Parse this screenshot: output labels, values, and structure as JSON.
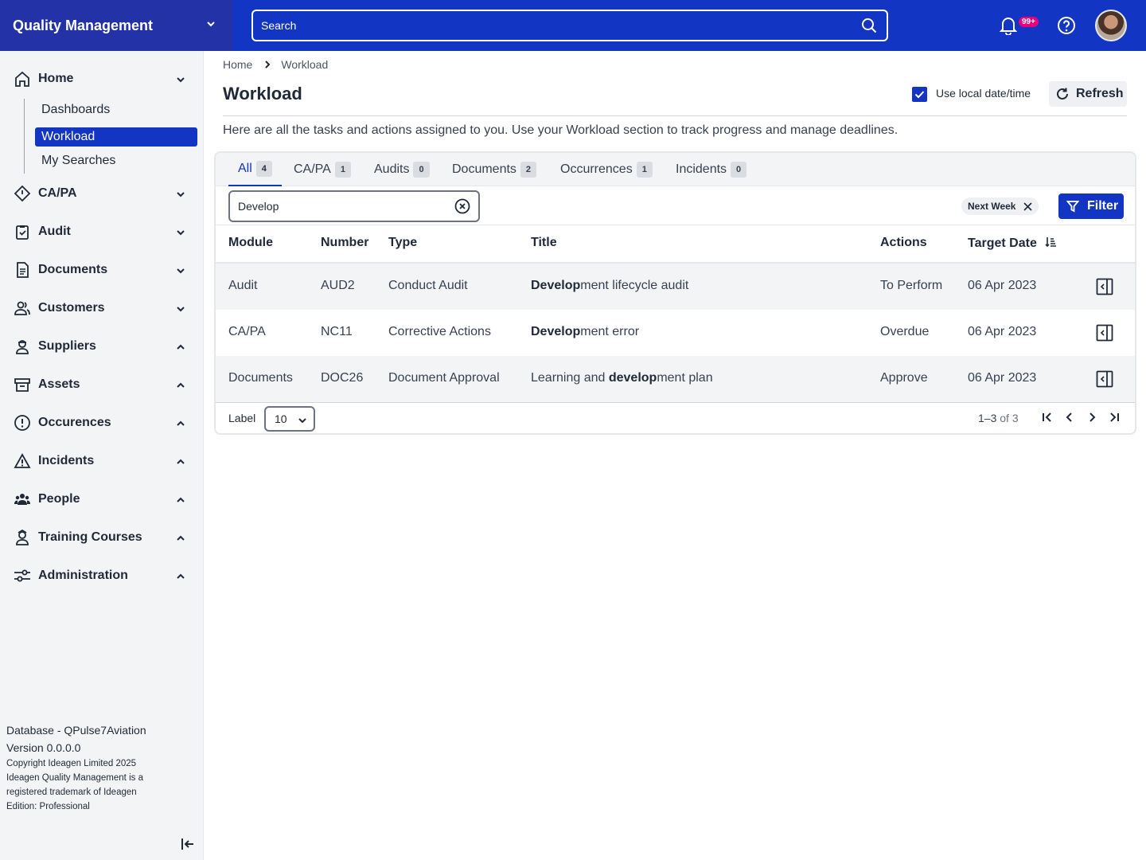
{
  "header": {
    "app_name": "Quality Management",
    "search_placeholder": "Search",
    "notification_count": "99+"
  },
  "sidebar": {
    "items": [
      {
        "label": "Home",
        "icon": "home-icon",
        "expanded": true
      },
      {
        "label": "CA/PA",
        "icon": "diamond-icon",
        "expanded": false
      },
      {
        "label": "Audit",
        "icon": "clipboard-check-icon",
        "expanded": false
      },
      {
        "label": "Documents",
        "icon": "document-icon",
        "expanded": false
      },
      {
        "label": "Customers",
        "icon": "customers-icon",
        "expanded": false
      },
      {
        "label": "Suppliers",
        "icon": "supplier-icon",
        "expanded": true
      },
      {
        "label": "Assets",
        "icon": "archive-icon",
        "expanded": true
      },
      {
        "label": "Occurences",
        "icon": "alert-circle-icon",
        "expanded": true
      },
      {
        "label": "Incidents",
        "icon": "warning-triangle-icon",
        "expanded": true
      },
      {
        "label": "People",
        "icon": "people-icon",
        "expanded": true
      },
      {
        "label": "Training Courses",
        "icon": "training-icon",
        "expanded": true
      },
      {
        "label": "Administration",
        "icon": "sliders-icon",
        "expanded": true
      }
    ],
    "home_sub": [
      "Dashboards",
      "Workload",
      "My Searches"
    ],
    "active_sub": "Workload",
    "footer": {
      "database": "Database - QPulse7Aviation",
      "version": "Version 0.0.0.0",
      "copyright": "Copyright Ideagen Limited 2025",
      "trademark_1": "Ideagen Quality Management is a",
      "trademark_2": "registered trademark of Ideagen",
      "edition": "Edition: Professional"
    }
  },
  "breadcrumb": [
    "Home",
    "Workload"
  ],
  "page": {
    "title": "Workload",
    "local_time_label": "Use local date/time",
    "local_time_checked": true,
    "refresh_label": "Refresh",
    "description": "Here are all the tasks and actions assigned to you. Use your Workload section to track progress and manage deadlines."
  },
  "tabs": [
    {
      "label": "All",
      "count": "4",
      "active": true
    },
    {
      "label": "CA/PA",
      "count": "1",
      "active": false
    },
    {
      "label": "Audits",
      "count": "0",
      "active": false
    },
    {
      "label": "Documents",
      "count": "2",
      "active": false
    },
    {
      "label": "Occurrences",
      "count": "1",
      "active": false
    },
    {
      "label": "Incidents",
      "count": "0",
      "active": false
    }
  ],
  "filter": {
    "search_value": "Develop",
    "chip": "Next Week",
    "button_label": "Filter"
  },
  "table": {
    "columns": [
      "Module",
      "Number",
      "Type",
      "Title",
      "Actions",
      "Target Date"
    ],
    "rows": [
      {
        "module": "Audit",
        "number": "AUD2",
        "type": "Conduct Audit",
        "title_pre": "",
        "title_match": "Develop",
        "title_post": "ment lifecycle audit",
        "action": "To Perform",
        "date": "06 Apr 2023"
      },
      {
        "module": "CA/PA",
        "number": "NC11",
        "type": "Corrective Actions",
        "title_pre": "",
        "title_match": "Develop",
        "title_post": "ment error",
        "action": "Overdue",
        "date": "06 Apr 2023"
      },
      {
        "module": "Documents",
        "number": "DOC26",
        "type": "Document Approval",
        "title_pre": "Learning and ",
        "title_match": "develop",
        "title_post": "ment plan",
        "action": "Approve",
        "date": "06 Apr 2023"
      }
    ]
  },
  "pager": {
    "label": "Label",
    "page_size": "10",
    "range": "1–3",
    "of_text": "of 3"
  },
  "colors": {
    "brand": "#1235c4",
    "brand_dark": "#2432a8",
    "badge": "#e6007e"
  }
}
